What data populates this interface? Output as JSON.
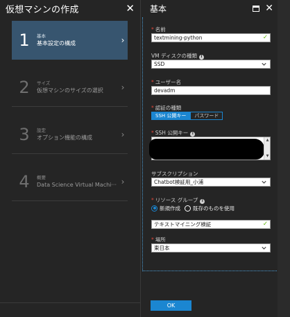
{
  "left_blade": {
    "title": "仮想マシンの作成",
    "steps": [
      {
        "number": "1",
        "small": "基本",
        "main": "基本設定の構成"
      },
      {
        "number": "2",
        "small": "サイズ",
        "main": "仮想マシンのサイズの選択"
      },
      {
        "number": "3",
        "small": "設定",
        "main": "オプション機能の構成"
      },
      {
        "number": "4",
        "small": "概要",
        "main": "Data Science Virtual Machi···"
      }
    ]
  },
  "right_blade": {
    "title": "基本",
    "fields": {
      "name": {
        "label": "名前",
        "value": "textmining-python"
      },
      "vm_disk": {
        "label": "VM ディスクの種類",
        "value": "SSD"
      },
      "user": {
        "label": "ユーザー名",
        "value": "devadm"
      },
      "auth": {
        "label": "認証の種類",
        "options": [
          "SSH 公開キー",
          "パスワード"
        ],
        "selected": "SSH 公開キー"
      },
      "ssh_key": {
        "label": "SSH 公開キー"
      },
      "subscription": {
        "label": "サブスクリプション",
        "value": "Chatbot検証用_小浦"
      },
      "resource_group": {
        "label": "リソース グループ",
        "options": [
          "新規作成",
          "既存のものを使用"
        ],
        "selected": "新規作成",
        "value": "テキストマイニング検証"
      },
      "location": {
        "label": "場所",
        "value": "東日本"
      }
    },
    "ok_label": "OK"
  },
  "colors": {
    "accent": "#1b86d1",
    "active_step": "#37556f",
    "required": "#e0473a",
    "valid_check": "#59b300"
  }
}
